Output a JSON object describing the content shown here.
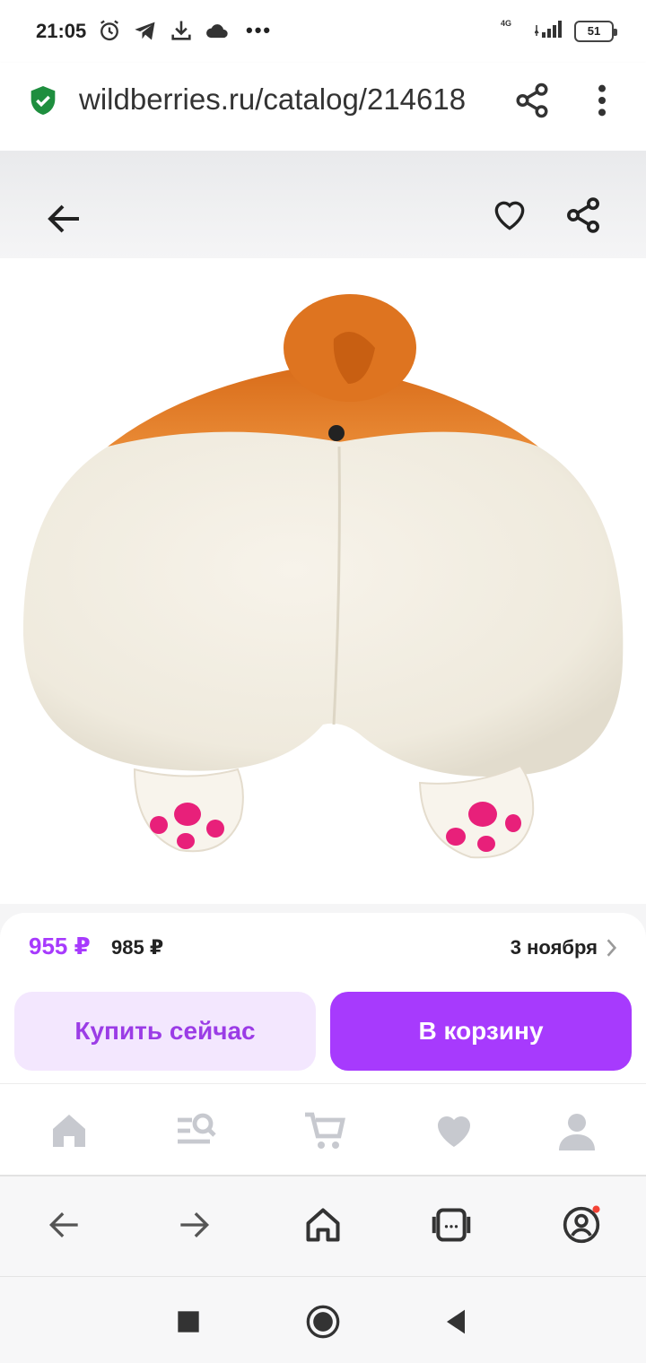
{
  "status_bar": {
    "time": "21:05",
    "network": "4G",
    "battery": "51",
    "icons": [
      "alarm-icon",
      "telegram-icon",
      "download-icon",
      "cloud-icon"
    ],
    "more": "•••"
  },
  "browser": {
    "url": "wildberries.ru/catalog/214618",
    "secure_icon": "shield-check-icon",
    "share_icon": "share-icon",
    "menu_icon": "more-vertical-icon"
  },
  "header": {
    "back_icon": "arrow-left-icon",
    "favorite_icon": "heart-outline-icon",
    "share_icon": "share-icon"
  },
  "product": {
    "price": "955 ₽",
    "old_price": "985 ₽",
    "delivery_date": "3 ноября",
    "buy_now_label": "Купить сейчас",
    "add_to_cart_label": "В корзину"
  },
  "app_tabs": [
    "home-icon",
    "catalog-search-icon",
    "cart-icon",
    "favorites-icon",
    "profile-icon"
  ],
  "browser_nav": [
    "back-icon",
    "forward-icon",
    "home-icon",
    "tabs-icon",
    "account-icon"
  ],
  "system_nav": [
    "recents-icon",
    "home-icon",
    "back-icon"
  ],
  "colors": {
    "accent": "#a73afd",
    "accent_light": "#f3e7fe",
    "icon_gray": "#c7c9cf",
    "secure_green": "#1e8e3e",
    "notification_dot": "#f44336"
  }
}
